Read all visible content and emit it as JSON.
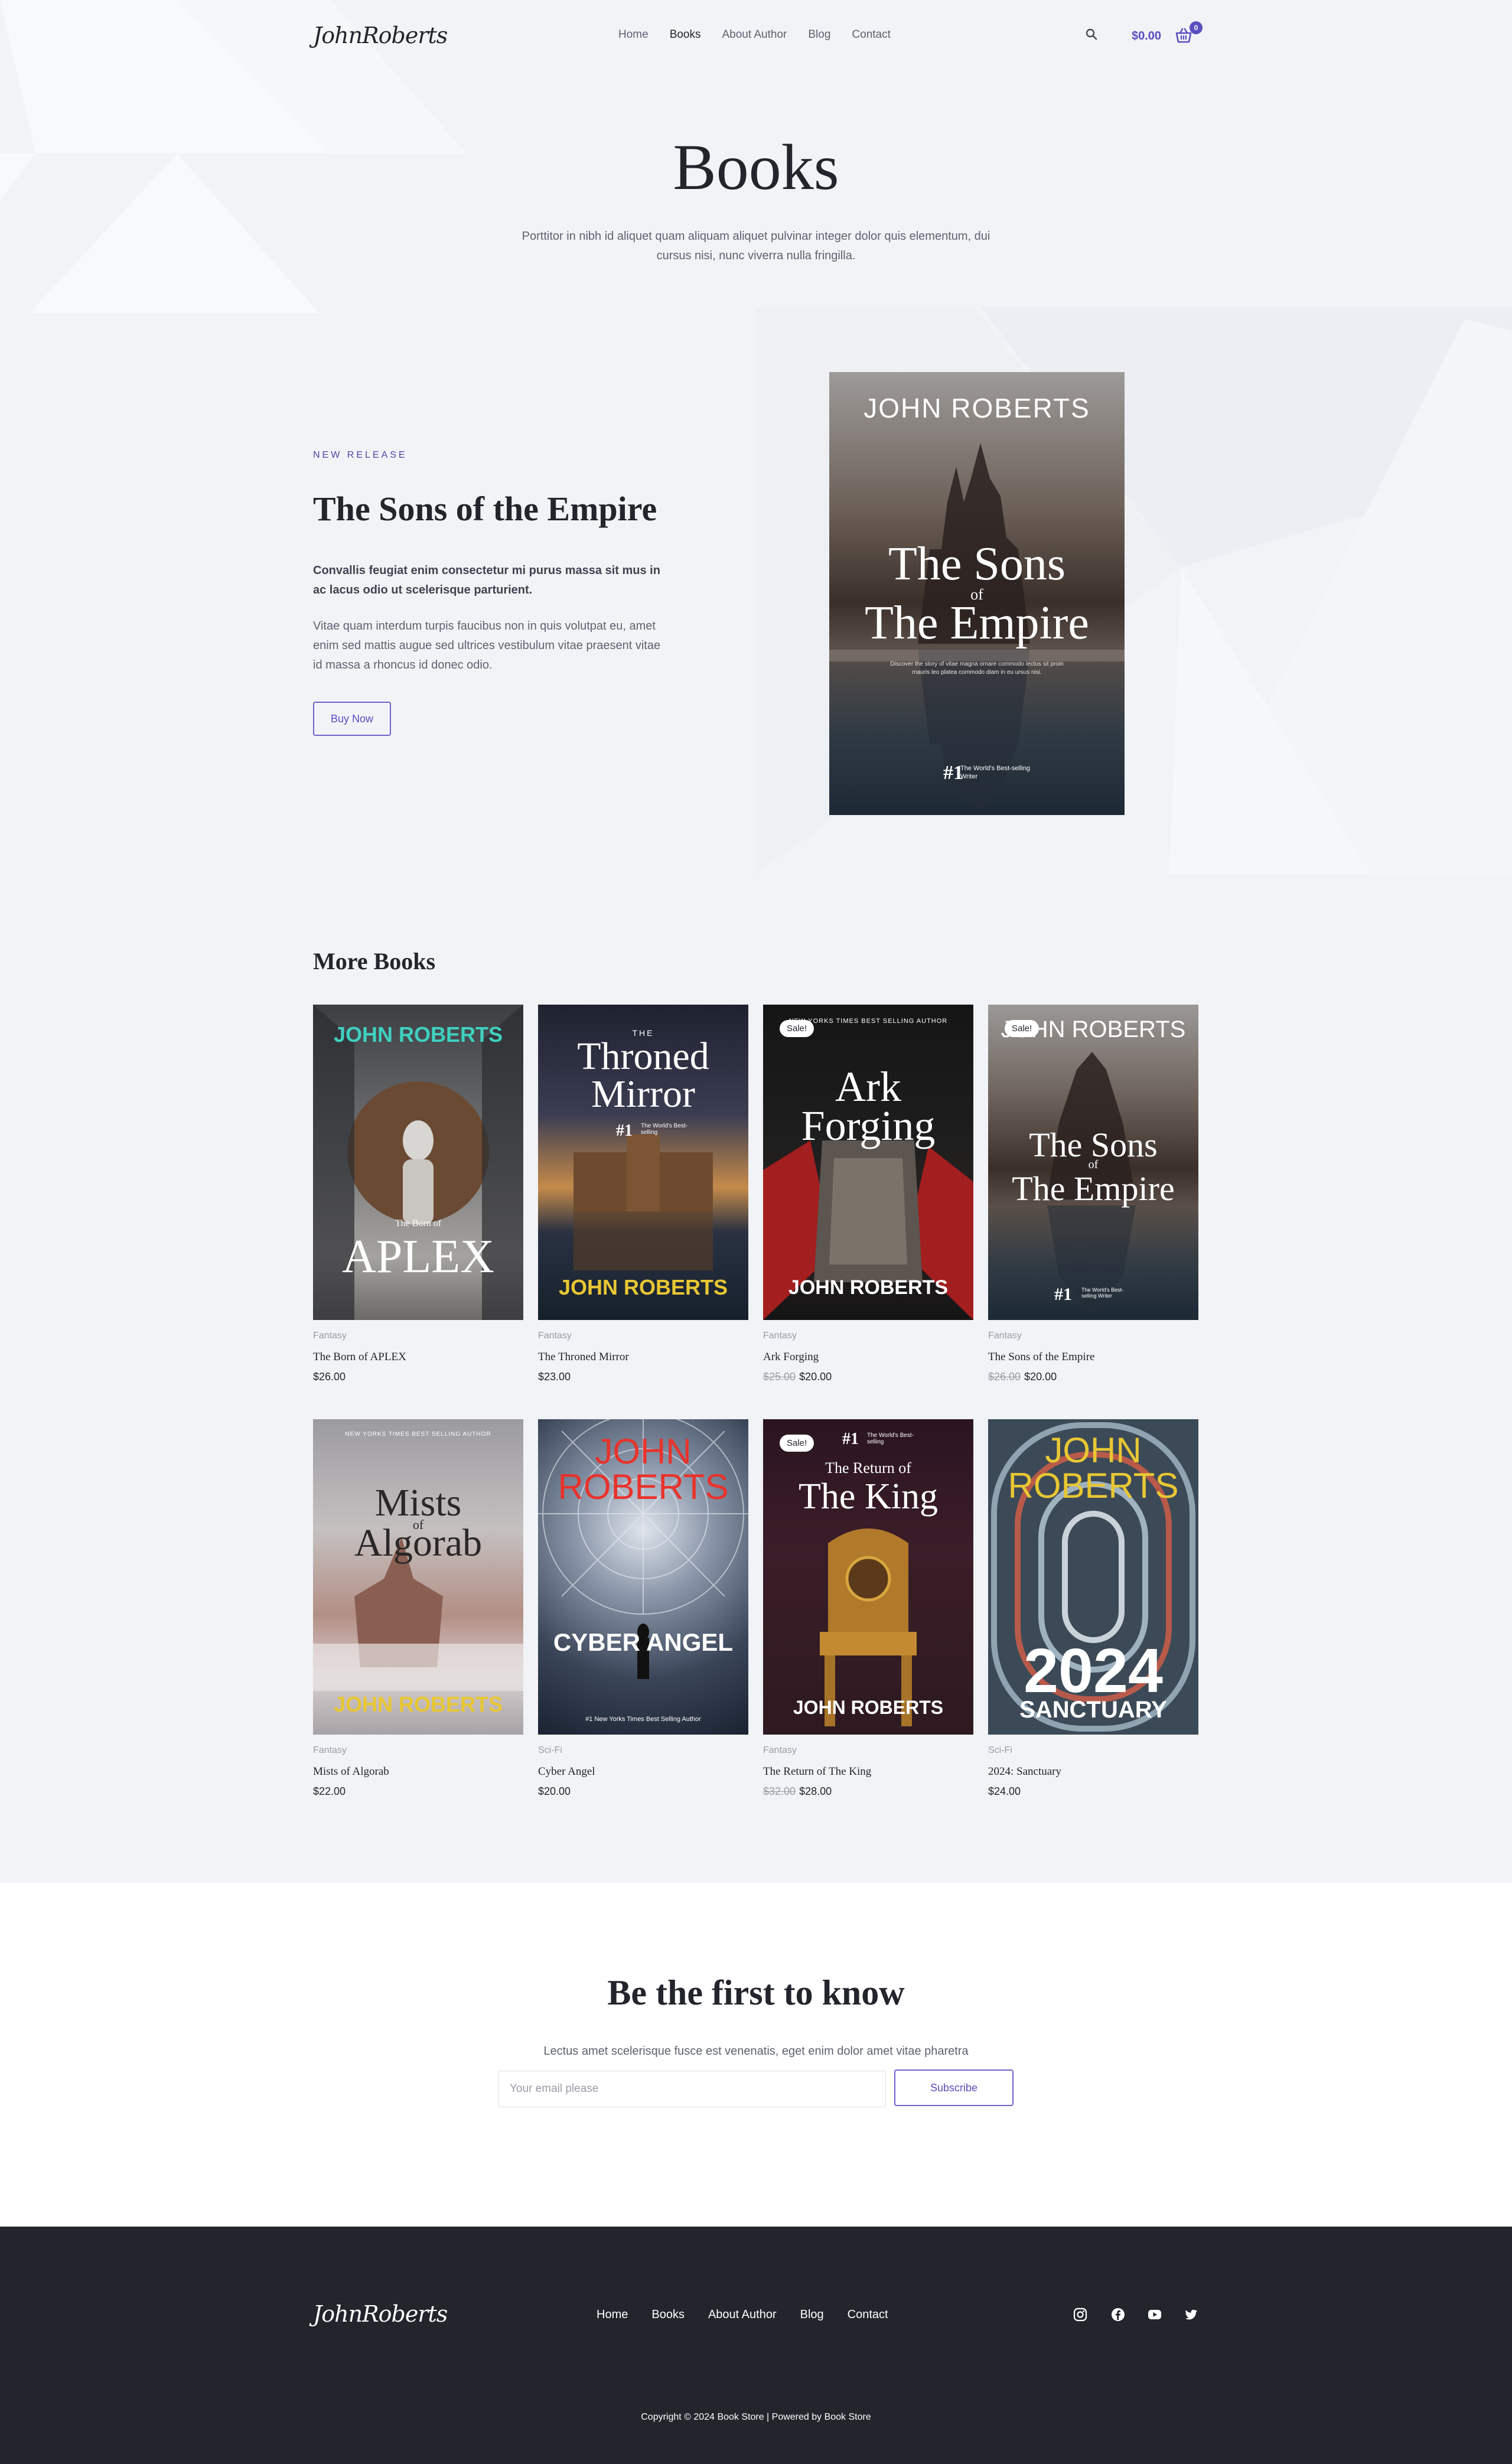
{
  "brand": {
    "logo": "JohnRoberts",
    "accent": "#5a4fc0",
    "dark": "#23252d",
    "background": "#f1f3f6"
  },
  "header": {
    "nav": [
      "Home",
      "Books",
      "About Author",
      "Blog",
      "Contact"
    ],
    "active_nav": "Books",
    "cart_total": "$0.00",
    "cart_count": "0",
    "icons": [
      "search-icon",
      "cart-icon"
    ]
  },
  "hero": {
    "title": "Books",
    "subtitle": "Porttitor in nibh id aliquet quam aliquam aliquet pulvinar integer dolor quis elementum, dui cursus nisi, nunc viverra nulla fringilla."
  },
  "featured": {
    "eyebrow": "NEW RELEASE",
    "title": "The Sons of the Empire",
    "lead": "Convallis feugiat enim consectetur mi purus massa sit mus in ac lacus odio ut scelerisque parturient.",
    "body": "Vitae quam interdum turpis faucibus non in quis volutpat eu, amet enim sed mattis augue sed ultrices vestibulum vitae praesent vitae id massa a rhoncus id donec odio.",
    "button": "Buy Now",
    "cover": {
      "author": "JOHN ROBERTS",
      "line1": "The Sons",
      "of": "of",
      "line2": "The Empire",
      "blurb": "Discover the story of vitae magna ornare commodo lectus sit proin mauris leo platea commodo diam in eu ursus nisi.",
      "rank": "#1",
      "rank_text": "The World's Best-selling Writer"
    }
  },
  "more_books": {
    "title": "More Books",
    "sale_label": "Sale!",
    "items": [
      {
        "category": "Fantasy",
        "name": "The Born of APLEX",
        "price": "$26.00",
        "old_price": "",
        "sale": false,
        "cover": {
          "top": "JOHN ROBERTS",
          "small": "The Born of",
          "big": "APLEX"
        }
      },
      {
        "category": "Fantasy",
        "name": "The Throned Mirror",
        "price": "$23.00",
        "old_price": "",
        "sale": false,
        "cover": {
          "small": "THE",
          "line1": "Throned",
          "line2": "Mirror",
          "rank": "#1",
          "rank_text": "The World's Best-selling",
          "author": "JOHN ROBERTS"
        }
      },
      {
        "category": "Fantasy",
        "name": "Ark Forging",
        "price": "$20.00",
        "old_price": "$25.00",
        "sale": true,
        "cover": {
          "top": "NEW YORKS TIMES BEST SELLING AUTHOR",
          "line1": "Ark",
          "line2": "Forging",
          "author": "JOHN ROBERTS"
        }
      },
      {
        "category": "Fantasy",
        "name": "The Sons of the Empire",
        "price": "$20.00",
        "old_price": "$26.00",
        "sale": true,
        "cover": {
          "author": "JOHN ROBERTS",
          "line1": "The Sons",
          "of": "of",
          "line2": "The Empire",
          "rank": "#1",
          "rank_text": "The World's Best-selling Writer"
        }
      },
      {
        "category": "Fantasy",
        "name": "Mists of Algorab",
        "price": "$22.00",
        "old_price": "",
        "sale": false,
        "cover": {
          "top": "NEW YORKS TIMES BEST SELLING AUTHOR",
          "line1": "Mists",
          "of": "of",
          "line2": "Algorab",
          "author": "JOHN ROBERTS"
        }
      },
      {
        "category": "Sci-Fi",
        "name": "Cyber Angel",
        "price": "$20.00",
        "old_price": "",
        "sale": false,
        "cover": {
          "author1": "JOHN",
          "author2": "ROBERTS",
          "line1": "CYBER ANGEL",
          "bottom": "#1 New Yorks Times Best Selling Author"
        }
      },
      {
        "category": "Fantasy",
        "name": "The Return of The King",
        "price": "$28.00",
        "old_price": "$32.00",
        "sale": true,
        "cover": {
          "rank": "#1",
          "rank_text": "The World's Best-selling",
          "small": "The Return of",
          "line1": "The King",
          "author": "JOHN ROBERTS"
        }
      },
      {
        "category": "Sci-Fi",
        "name": "2024: Sanctuary",
        "price": "$24.00",
        "old_price": "",
        "sale": false,
        "cover": {
          "author1": "JOHN",
          "author2": "ROBERTS",
          "line1": "2024",
          "line2": "SANCTUARY"
        }
      }
    ]
  },
  "subscribe": {
    "title": "Be the first to know",
    "text": "Lectus amet scelerisque fusce est venenatis, eget enim dolor amet vitae pharetra",
    "placeholder": "Your email please",
    "button": "Subscribe"
  },
  "footer": {
    "logo": "JohnRoberts",
    "nav": [
      "Home",
      "Books",
      "About Author",
      "Blog",
      "Contact"
    ],
    "social": [
      "instagram-icon",
      "facebook-icon",
      "youtube-icon",
      "twitter-icon"
    ],
    "copyright": "Copyright © 2024 Book Store | Powered by Book Store"
  }
}
